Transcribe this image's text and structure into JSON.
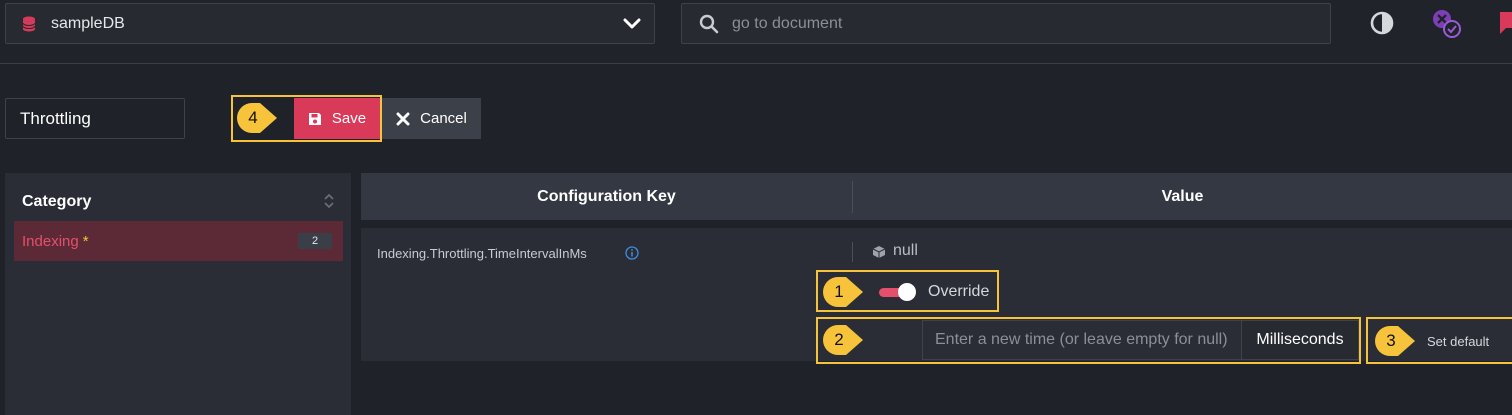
{
  "top_bar": {
    "database_name": "sampleDB",
    "search_placeholder": "go to document"
  },
  "toolbar": {
    "name_value": "Throttling",
    "save_label": "Save",
    "cancel_label": "Cancel"
  },
  "category_panel": {
    "header": "Category",
    "items": [
      {
        "label": "Indexing",
        "modified_marker": "*",
        "count": "2"
      }
    ]
  },
  "table": {
    "columns": [
      "Configuration Key",
      "Value"
    ],
    "rows": [
      {
        "key": "Indexing.Throttling.TimeIntervalInMs",
        "current_value": "null",
        "override_label": "Override",
        "override_enabled": true,
        "input_placeholder": "Enter a new time (or leave empty for null)",
        "unit": "Milliseconds",
        "set_default_label": "Set default"
      }
    ]
  },
  "callouts": [
    "1",
    "2",
    "3",
    "4"
  ],
  "colors": {
    "accent": "#d93a5a",
    "highlight": "#f6c33a",
    "background": "#1f2228",
    "panel": "#2a2d35"
  },
  "icons": [
    "database-icon",
    "chevron-down-icon",
    "search-icon",
    "contrast-icon",
    "notification-icon",
    "chat-icon",
    "save-icon",
    "close-icon",
    "sort-icon",
    "info-icon",
    "cube-icon"
  ]
}
